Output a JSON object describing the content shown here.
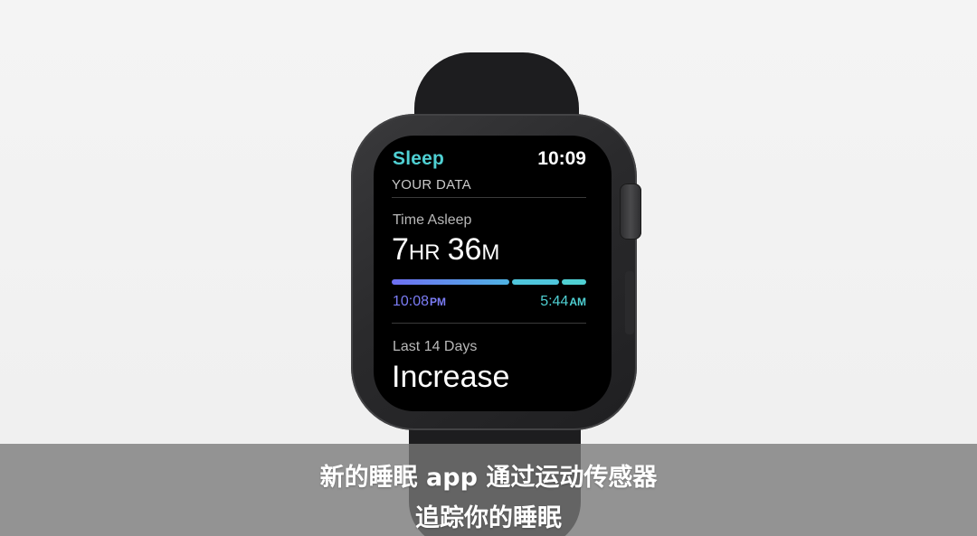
{
  "watch": {
    "app_title": "Sleep",
    "clock": "10:09",
    "section_header": "YOUR DATA",
    "time_asleep": {
      "label": "Time Asleep",
      "hours": "7",
      "hours_unit": "HR",
      "minutes": "36",
      "minutes_unit": "M"
    },
    "timeline": {
      "start_time": "10:08",
      "start_suffix": "PM",
      "end_time": "5:44",
      "end_suffix": "AM"
    },
    "trend": {
      "label": "Last 14 Days",
      "value": "Increase"
    }
  },
  "subtitle": {
    "line1": "新的睡眠 app 通过运动传感器",
    "line2": "追踪你的睡眠"
  },
  "colors": {
    "accent": "#4fd0d3",
    "start_time": "#7b7cf5",
    "screen": "#000000",
    "case": "#2a2a2c"
  }
}
